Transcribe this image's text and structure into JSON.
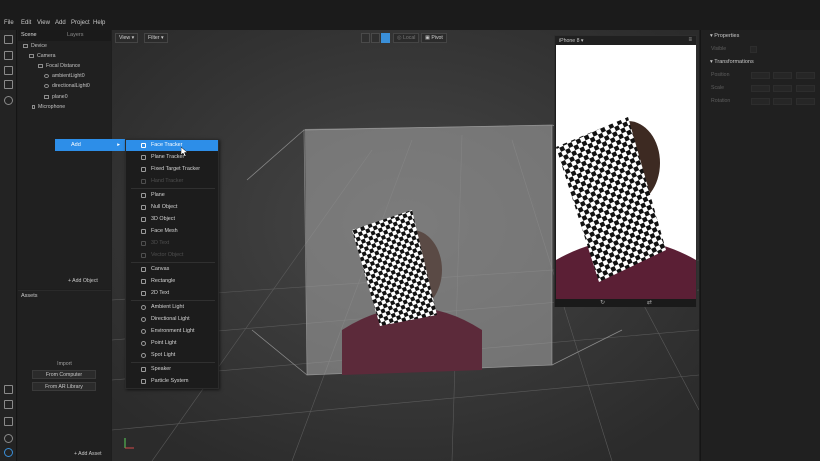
{
  "menu": [
    "File",
    "Edit",
    "View",
    "Add",
    "Project",
    "Help"
  ],
  "scene": {
    "tabs": [
      "Scene",
      "Layers"
    ],
    "tree": [
      {
        "label": "Device",
        "depth": 0
      },
      {
        "label": "Camera",
        "depth": 1
      },
      {
        "label": "Focal Distance",
        "depth": 2
      },
      {
        "label": "ambientLight0",
        "depth": 3
      },
      {
        "label": "directionalLight0",
        "depth": 3
      },
      {
        "label": "plane0",
        "depth": 3
      },
      {
        "label": "Microphone",
        "depth": 0
      }
    ],
    "add_object": "+ Add Object"
  },
  "assets": {
    "title": "Assets",
    "import_label": "Import",
    "from_computer": "From Computer",
    "from_library": "From AR Library",
    "add_asset": "+ Add Asset"
  },
  "viewport": {
    "view_label": "View",
    "filter_label": "Filter",
    "local_label": "Local",
    "pivot_label": "Pivot"
  },
  "preview": {
    "device": "iPhone 8"
  },
  "properties": {
    "title": "Properties",
    "visible_label": "Visible",
    "transformations": "Transformations",
    "rows": [
      "Position",
      "Scale",
      "Rotation"
    ]
  },
  "context_menu": {
    "parent": "Add",
    "items": [
      {
        "label": "Face Tracker",
        "enabled": true,
        "hover": true
      },
      {
        "label": "Plane Tracker",
        "enabled": true
      },
      {
        "label": "Fixed Target Tracker",
        "enabled": true
      },
      {
        "label": "Hand Tracker",
        "enabled": false
      },
      {
        "label": "Plane",
        "enabled": true
      },
      {
        "label": "Null Object",
        "enabled": true
      },
      {
        "label": "3D Object",
        "enabled": true
      },
      {
        "label": "Face Mesh",
        "enabled": true
      },
      {
        "label": "3D Text",
        "enabled": false
      },
      {
        "label": "Vector Object",
        "enabled": false
      },
      {
        "label": "Canvas",
        "enabled": true
      },
      {
        "label": "Rectangle",
        "enabled": true
      },
      {
        "label": "2D Text",
        "enabled": true
      },
      {
        "label": "Ambient Light",
        "enabled": true
      },
      {
        "label": "Directional Light",
        "enabled": true
      },
      {
        "label": "Environment Light",
        "enabled": true
      },
      {
        "label": "Point Light",
        "enabled": true
      },
      {
        "label": "Spot Light",
        "enabled": true
      },
      {
        "label": "Speaker",
        "enabled": true
      },
      {
        "label": "Particle System",
        "enabled": true
      }
    ]
  },
  "colors": {
    "accent": "#2d8ee8"
  }
}
